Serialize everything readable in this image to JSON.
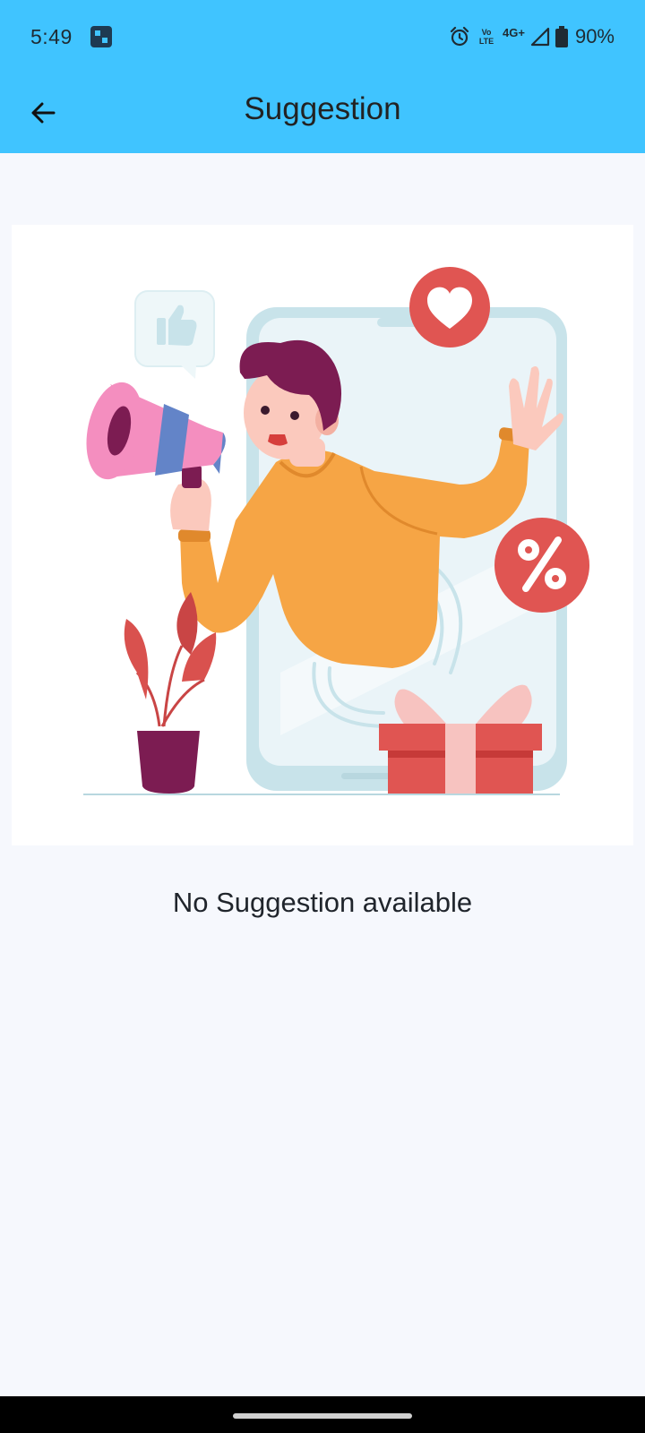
{
  "status_bar": {
    "time": "5:49",
    "volte_label": "Vo LTE",
    "network_type": "4G+",
    "battery": "90%"
  },
  "toolbar": {
    "title": "Suggestion"
  },
  "empty_state": {
    "message": "No Suggestion available",
    "illustration": "promotion-megaphone-illustration"
  },
  "colors": {
    "app_bar": "#40c4ff",
    "background": "#f6f8fd",
    "accent_red": "#e05552",
    "sweater_orange": "#f6a545"
  }
}
